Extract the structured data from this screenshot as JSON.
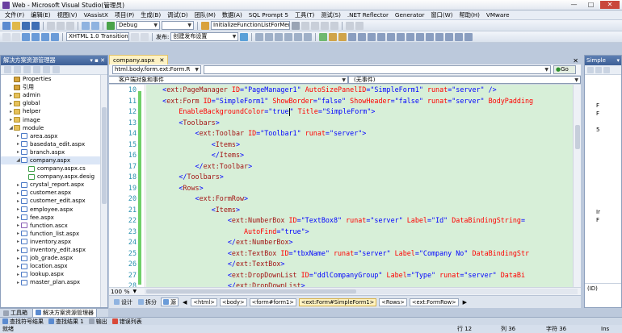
{
  "window": {
    "title": "Web - Microsoft Visual Studio(管理员)",
    "minimize": "—",
    "maximize": "□",
    "close": "✕"
  },
  "menu": [
    "文件(F)",
    "编辑(E)",
    "视图(V)",
    "VAssistX",
    "项目(P)",
    "生成(B)",
    "调试(D)",
    "团队(M)",
    "数据(A)",
    "SQL Prompt 5",
    "工具(T)",
    "测试(S)",
    ".NET Reflector",
    "Generator",
    "窗口(W)",
    "帮助(H)",
    "VMware"
  ],
  "toolbar1": {
    "config": "Debug",
    "find": "InitializeFunctionListForMenu"
  },
  "toolbar2": {
    "doctype": "XHTML 1.0 Transition",
    "publish_label": "发布:",
    "publish_setting": "创建发布设置"
  },
  "solution_explorer": {
    "title": "解决方案资源管理器",
    "pin": "▾ ▪ ✕",
    "items": [
      {
        "label": "Properties",
        "exp": "",
        "icon": "pfolder",
        "indent": 1
      },
      {
        "label": "引用",
        "exp": "",
        "icon": "pfolder",
        "indent": 1
      },
      {
        "label": "admin",
        "exp": "▸",
        "icon": "folder",
        "indent": 1
      },
      {
        "label": "global",
        "exp": "▸",
        "icon": "folder",
        "indent": 1
      },
      {
        "label": "helper",
        "exp": "▸",
        "icon": "folder",
        "indent": 1
      },
      {
        "label": "image",
        "exp": "▸",
        "icon": "folder",
        "indent": 1
      },
      {
        "label": "module",
        "exp": "◢",
        "icon": "folder",
        "indent": 1
      },
      {
        "label": "area.aspx",
        "exp": "▸",
        "icon": "aspx",
        "indent": 2
      },
      {
        "label": "basedata_edit.aspx",
        "exp": "▸",
        "icon": "aspx",
        "indent": 2
      },
      {
        "label": "branch.aspx",
        "exp": "▸",
        "icon": "aspx",
        "indent": 2
      },
      {
        "label": "company.aspx",
        "exp": "◢",
        "icon": "aspx",
        "indent": 2
      },
      {
        "label": "company.aspx.cs",
        "exp": "",
        "icon": "cs",
        "indent": 3
      },
      {
        "label": "company.aspx.desig",
        "exp": "",
        "icon": "cs",
        "indent": 3
      },
      {
        "label": "crystal_report.aspx",
        "exp": "▸",
        "icon": "aspx",
        "indent": 2
      },
      {
        "label": "customer.aspx",
        "exp": "▸",
        "icon": "aspx",
        "indent": 2
      },
      {
        "label": "customer_edit.aspx",
        "exp": "▸",
        "icon": "aspx",
        "indent": 2
      },
      {
        "label": "employee.aspx",
        "exp": "▸",
        "icon": "aspx",
        "indent": 2
      },
      {
        "label": "fee.aspx",
        "exp": "▸",
        "icon": "aspx",
        "indent": 2
      },
      {
        "label": "function.ascx",
        "exp": "▸",
        "icon": "ascx",
        "indent": 2
      },
      {
        "label": "function_list.aspx",
        "exp": "▸",
        "icon": "aspx",
        "indent": 2
      },
      {
        "label": "inventory.aspx",
        "exp": "▸",
        "icon": "aspx",
        "indent": 2
      },
      {
        "label": "inventory_edit.aspx",
        "exp": "▸",
        "icon": "aspx",
        "indent": 2
      },
      {
        "label": "job_grade.aspx",
        "exp": "▸",
        "icon": "aspx",
        "indent": 2
      },
      {
        "label": "location.aspx",
        "exp": "▸",
        "icon": "aspx",
        "indent": 2
      },
      {
        "label": "lookup.aspx",
        "exp": "▸",
        "icon": "aspx",
        "indent": 2
      },
      {
        "label": "master_plan.aspx",
        "exp": "▸",
        "icon": "aspx",
        "indent": 2
      }
    ],
    "tabs": [
      "工具箱",
      "解决方案资源管理器"
    ]
  },
  "document": {
    "tab": "company.aspx",
    "nav_left": "html.body.form.ext:Form.R",
    "go": "Go",
    "client_objects": "客户端对象和事件",
    "events": "(无事件)",
    "line_numbers": [
      "10",
      "11",
      "12",
      "13",
      "14",
      "15",
      "16",
      "17",
      "18",
      "19",
      "20",
      "21",
      "22",
      "23",
      "24",
      "25",
      "26",
      "27",
      "28"
    ],
    "zoom": "100 %",
    "view_design": "设计",
    "view_split": "拆分",
    "view_source": "源",
    "breadcrumbs": [
      "<html>",
      "<body>",
      "<form#form1>",
      "<ext:Form#SimpleForm1>",
      "<Rows>",
      "<ext:FormRow>"
    ]
  },
  "right_panel": {
    "title": "Simple",
    "items": [
      "",
      "",
      "",
      "F",
      "F",
      "",
      "5",
      "",
      "",
      "",
      "",
      "",
      "",
      "",
      "",
      "",
      "Ir",
      "F",
      "",
      "",
      "",
      "",
      "",
      "",
      ""
    ],
    "id_label": "(ID)"
  },
  "bottom_tabs": [
    "查找符号结果",
    "查找结果 1",
    "输出",
    "错误列表"
  ],
  "status": {
    "ready": "就绪",
    "row": "行 12",
    "col": "列 36",
    "char": "字符 36",
    "ins": "Ins"
  }
}
